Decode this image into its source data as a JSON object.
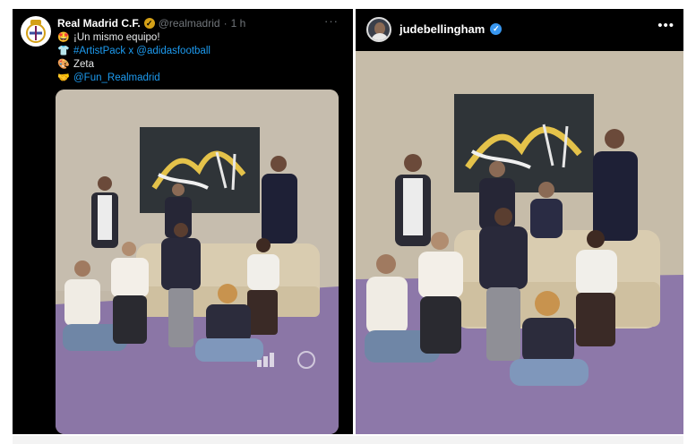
{
  "tweet": {
    "display_name": "Real Madrid C.F.",
    "handle": "@realmadrid",
    "separator": "·",
    "time": "1 h",
    "more": "···",
    "lines": [
      {
        "emoji": "🤩",
        "text": "¡Un mismo equipo!",
        "is_link": false
      },
      {
        "emoji": "👕",
        "text": "#ArtistPack x @adidasfootball",
        "is_link": true
      },
      {
        "emoji": "🎨",
        "text": "Zeta",
        "is_link": false
      },
      {
        "emoji": "🤝",
        "text": "@Fun_Realmadrid",
        "is_link": true
      }
    ],
    "photo_description_icons": [
      "adidas-logo",
      "real-madrid-crest"
    ]
  },
  "instagram": {
    "username": "judebellingham",
    "more": "•••"
  },
  "colors": {
    "x_background": "#000000",
    "link_blue": "#1d9bf0",
    "gold_verified": "#d4a017",
    "ig_verified_blue": "#3897f0",
    "studio_wall": "#c3b9a9",
    "purple_floor": "#8f79a9",
    "cream_sofa": "#d9ccb0"
  }
}
